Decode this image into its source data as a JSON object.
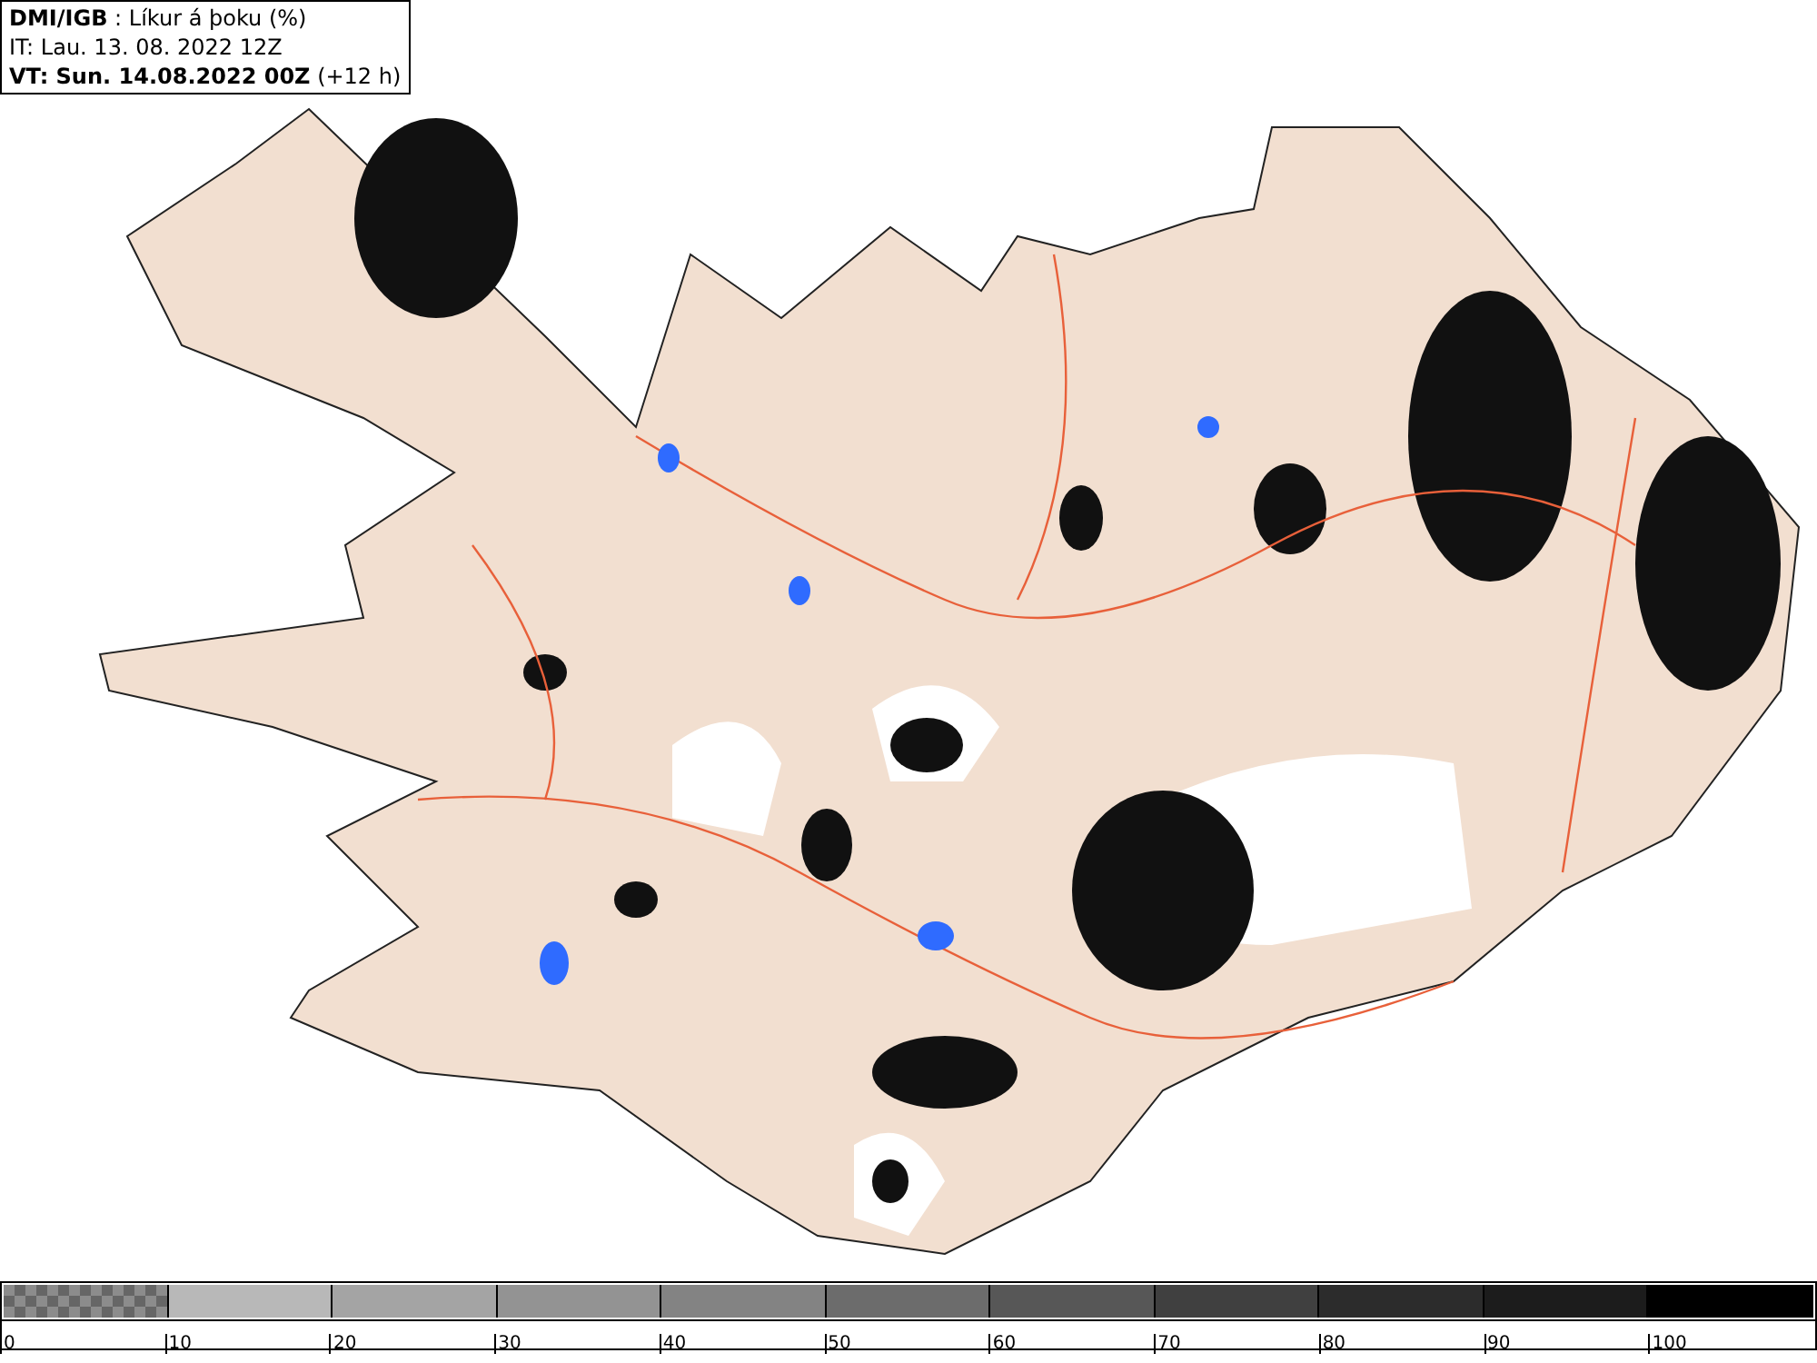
{
  "header": {
    "lines": [
      "**DMI/IGB** : Líkur á þoku (%)",
      "IT: Lau. 13. 08. 2022 12Z",
      "**VT: Sun. 14.08.2022 00Z** (+12 h)"
    ]
  },
  "legend": {
    "bins": [
      {
        "label": "0",
        "color": "#8c8c8c",
        "kind": "checkered"
      },
      {
        "label": "10",
        "color": "#b8b8b8",
        "kind": "solid"
      },
      {
        "label": "20",
        "color": "#a4a4a4",
        "kind": "solid"
      },
      {
        "label": "30",
        "color": "#939393",
        "kind": "solid"
      },
      {
        "label": "40",
        "color": "#838383",
        "kind": "solid"
      },
      {
        "label": "50",
        "color": "#6c6c6c",
        "kind": "solid"
      },
      {
        "label": "60",
        "color": "#575757",
        "kind": "solid"
      },
      {
        "label": "70",
        "color": "#404040",
        "kind": "solid"
      },
      {
        "label": "80",
        "color": "#2c2c2c",
        "kind": "solid"
      },
      {
        "label": "90",
        "color": "#1c1c1c",
        "kind": "solid"
      },
      {
        "label": "100",
        "color": "#000000",
        "kind": "solid"
      }
    ]
  }
}
